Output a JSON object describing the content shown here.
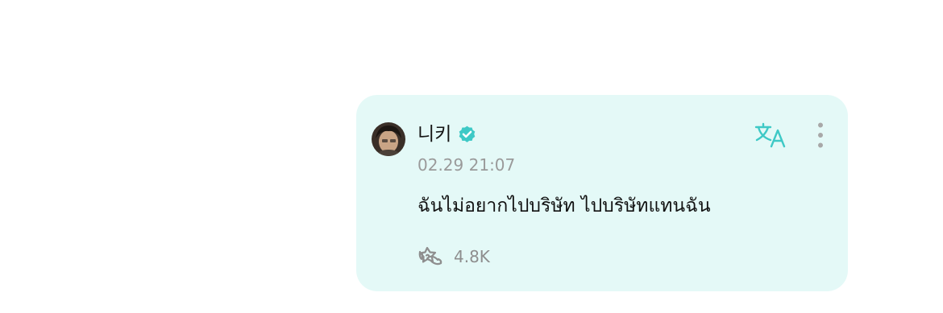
{
  "post": {
    "author_name": "니키",
    "verified": true,
    "timestamp": "02.29 21:07",
    "message": "ฉันไม่อยากไปบริษัท ไปบริษัทแทนฉัน",
    "reaction_count": "4.8K"
  },
  "icons": {
    "verified": "verified-badge-icon",
    "translate": "translate-icon",
    "more": "more-vertical-icon",
    "reaction": "reaction-icon"
  },
  "colors": {
    "bubble_background": "#e4f9f7",
    "accent": "#3ec9c6",
    "timestamp": "#9a9a9a",
    "text": "#111111"
  }
}
